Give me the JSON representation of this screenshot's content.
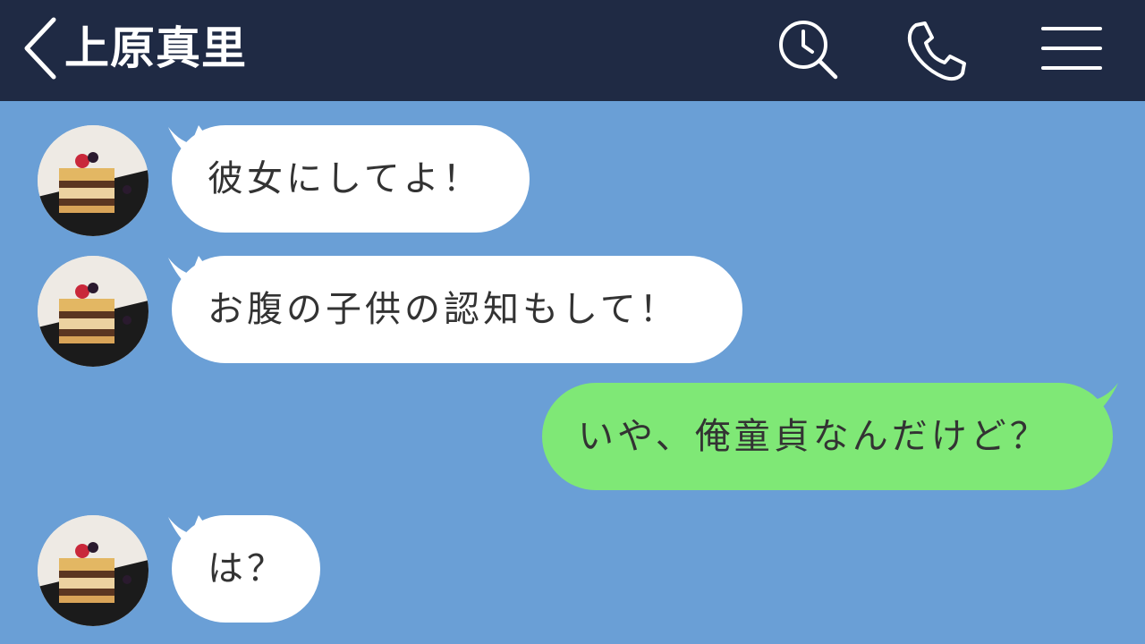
{
  "header": {
    "contact_name": "上原真里",
    "icons": {
      "back": "chevron-left-icon",
      "search": "search-history-icon",
      "call": "phone-icon",
      "menu": "hamburger-menu-icon"
    }
  },
  "colors": {
    "header_bg": "#1f2a44",
    "chat_bg": "#6a9fd6",
    "incoming_bubble": "#ffffff",
    "outgoing_bubble": "#7fe876",
    "text": "#333333"
  },
  "messages": [
    {
      "direction": "incoming",
      "text": "彼女にしてよ！"
    },
    {
      "direction": "incoming",
      "text": "お腹の子供の認知もして！"
    },
    {
      "direction": "outgoing",
      "text": "いや、俺童貞なんだけど？"
    },
    {
      "direction": "incoming",
      "text": "は？"
    }
  ]
}
